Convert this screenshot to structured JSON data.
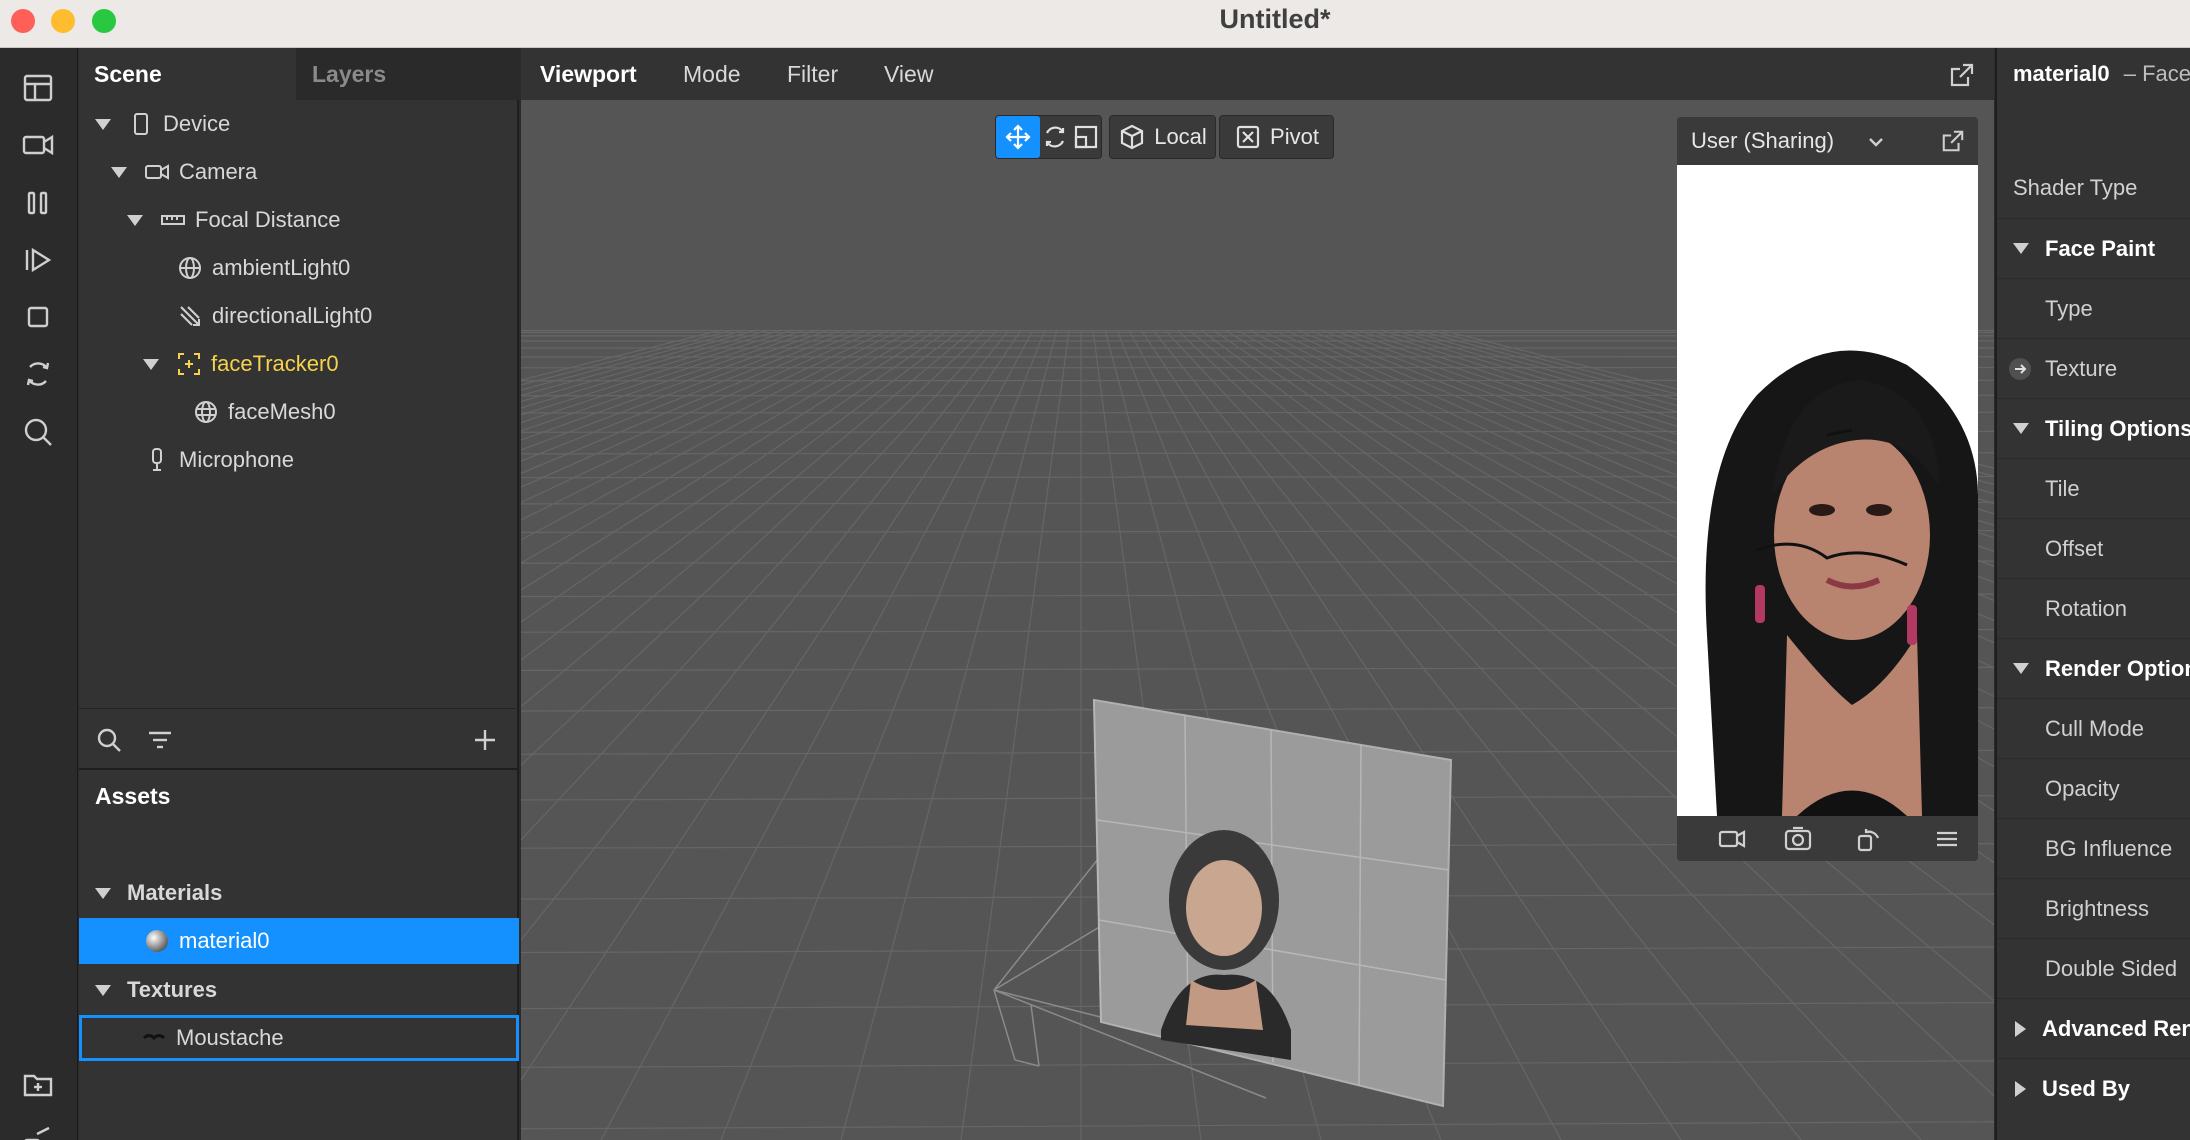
{
  "window": {
    "title": "Untitled*"
  },
  "scene_panel": {
    "tabs": {
      "scene": "Scene",
      "layers": "Layers"
    },
    "tree": {
      "device": "Device",
      "camera": "Camera",
      "focal_distance": "Focal Distance",
      "ambient_light": "ambientLight0",
      "directional_light": "directionalLight0",
      "face_tracker": "faceTracker0",
      "face_mesh": "faceMesh0",
      "microphone": "Microphone"
    }
  },
  "assets": {
    "title": "Assets",
    "materials_label": "Materials",
    "material_item": "material0",
    "textures_label": "Textures",
    "texture_item": "Moustache"
  },
  "viewport": {
    "menu": {
      "viewport": "Viewport",
      "mode": "Mode",
      "filter": "Filter",
      "view": "View"
    },
    "toolbar": {
      "local": "Local",
      "pivot": "Pivot"
    },
    "simulator": {
      "device": "User (Sharing)"
    }
  },
  "inspector": {
    "title": "material0",
    "subtitle": "– Face",
    "rows": {
      "shader_type": "Shader Type",
      "face_paint": "Face Paint",
      "type": "Type",
      "texture": "Texture",
      "tiling_options": "Tiling Options",
      "tile": "Tile",
      "offset": "Offset",
      "rotation": "Rotation",
      "render_options": "Render Options",
      "cull_mode": "Cull Mode",
      "opacity": "Opacity",
      "bg_influence": "BG Influence",
      "brightness": "Brightness",
      "double_sided": "Double Sided",
      "advanced_render": "Advanced Render",
      "used_by": "Used By"
    }
  },
  "colors": {
    "accent": "#1590ff",
    "highlight": "#f5d24a",
    "panel": "#333333",
    "viewport": "#555555"
  }
}
